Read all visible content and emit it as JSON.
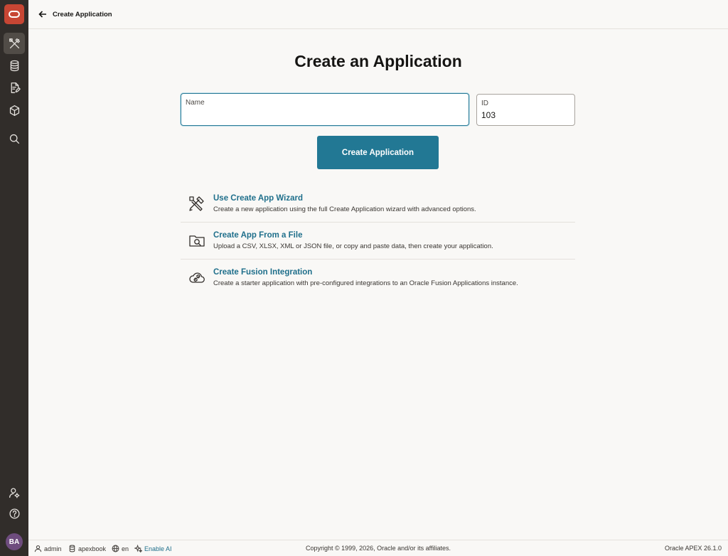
{
  "topbar": {
    "title": "Create Application"
  },
  "sidebar": {
    "items": [
      {
        "name": "app-builder",
        "icon": "tools-icon",
        "active": true
      },
      {
        "name": "sql-workshop",
        "icon": "database-icon"
      },
      {
        "name": "team-development",
        "icon": "document-edit-icon"
      },
      {
        "name": "gallery",
        "icon": "cube-icon"
      },
      {
        "name": "search",
        "icon": "search-icon"
      },
      {
        "name": "administration",
        "icon": "user-settings-icon"
      },
      {
        "name": "help",
        "icon": "help-icon"
      }
    ],
    "avatar": "BA"
  },
  "main": {
    "title": "Create an Application",
    "name_field": {
      "label": "Name",
      "value": ""
    },
    "id_field": {
      "label": "ID",
      "value": "103"
    },
    "create_button": "Create Application",
    "options": [
      {
        "title": "Use Create App Wizard",
        "desc": "Create a new application using the full Create Application wizard with advanced options.",
        "icon": "wizard-tools-icon"
      },
      {
        "title": "Create App From a File",
        "desc": "Upload a CSV, XLSX, XML or JSON file, or copy and paste data, then create your application.",
        "icon": "folder-search-icon"
      },
      {
        "title": "Create Fusion Integration",
        "desc": "Create a starter application with pre-configured integrations to an Oracle Fusion Applications instance.",
        "icon": "cloud-link-icon"
      }
    ]
  },
  "footer": {
    "user": "admin",
    "workspace": "apexbook",
    "language": "en",
    "ai": "Enable AI",
    "copyright": "Copyright © 1999, 2026, Oracle and/or its affiliates.",
    "version": "Oracle APEX 26.1.0"
  },
  "colors": {
    "sidebar": "#312d2a",
    "brand": "#c74634",
    "primary": "#227894",
    "link": "#1f6f8b"
  }
}
